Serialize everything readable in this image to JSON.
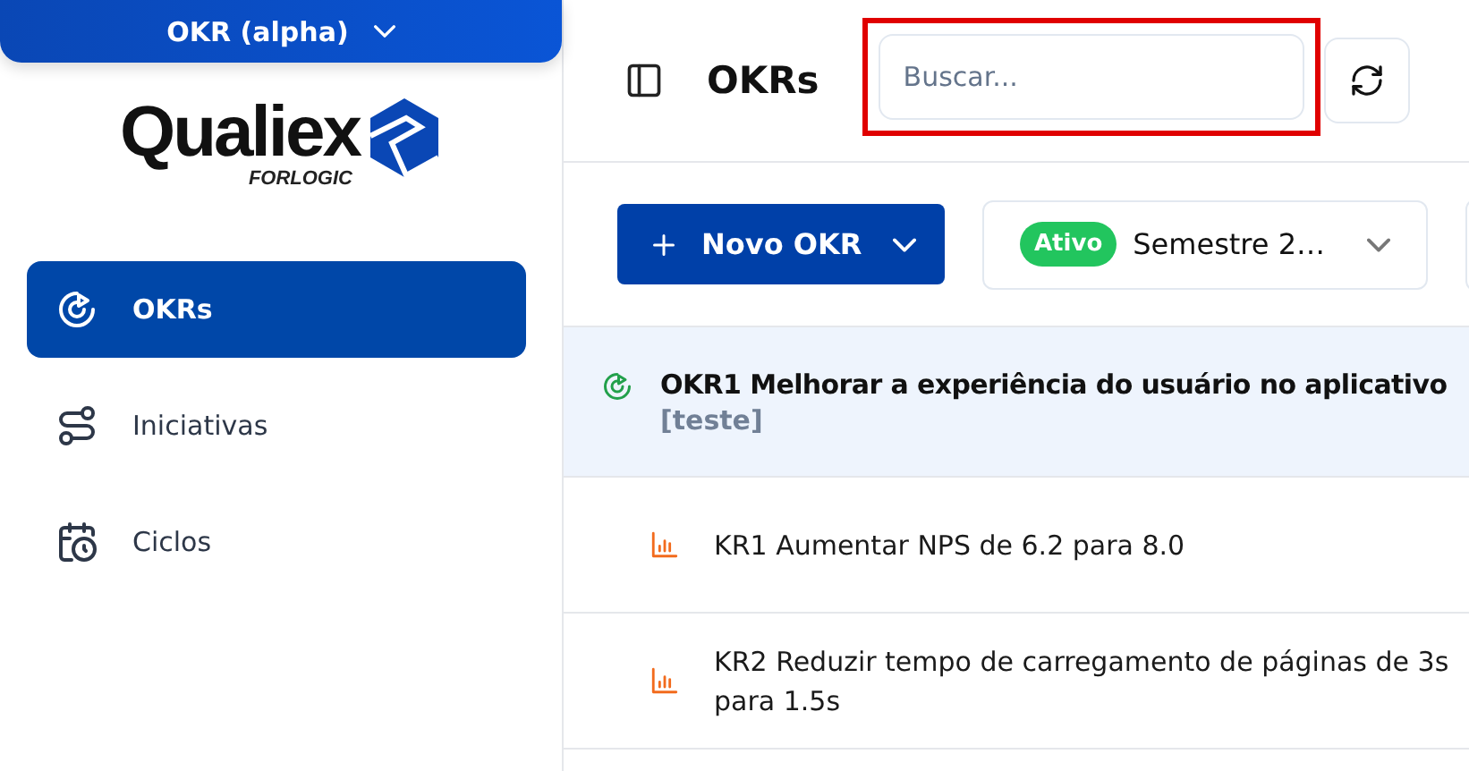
{
  "app_switcher": {
    "label": "OKR (alpha)"
  },
  "logo": {
    "name": "Qualiex",
    "subtitle": "FORLOGIC"
  },
  "sidebar": {
    "items": [
      {
        "label": "OKRs",
        "selected": true
      },
      {
        "label": "Iniciativas",
        "selected": false
      },
      {
        "label": "Ciclos",
        "selected": false
      }
    ]
  },
  "header": {
    "title": "OKRs",
    "search": {
      "placeholder": "Buscar...",
      "highlighted": true
    }
  },
  "toolbar": {
    "new_button": "Novo OKR",
    "cycle": {
      "status": "Ativo",
      "label": "Semestre 2…"
    }
  },
  "okrs": [
    {
      "kind": "objective",
      "title": "OKR1 Melhorar a experiência do usuário no aplicativo",
      "tag": "[teste]"
    },
    {
      "kind": "key_result",
      "title": "KR1 Aumentar NPS de 6.2 para 8.0"
    },
    {
      "kind": "key_result",
      "title": "KR2 Reduzir tempo de carregamento de páginas de 3s para 1.5s"
    }
  ]
}
